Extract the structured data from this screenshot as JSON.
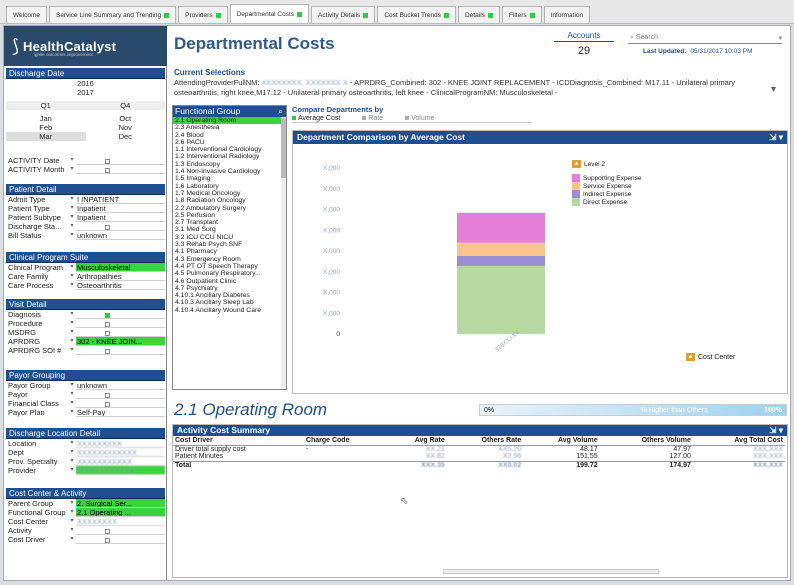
{
  "tabs": [
    {
      "label": "Welcome",
      "dot": false
    },
    {
      "label": "Service Line Summary and Trending",
      "dot": true
    },
    {
      "label": "Providers",
      "dot": true
    },
    {
      "label": "Departmental Costs",
      "dot": true,
      "active": true
    },
    {
      "label": "Activity Details",
      "dot": true
    },
    {
      "label": "Cost Bucket Trends",
      "dot": true
    },
    {
      "label": "Details",
      "dot": true
    },
    {
      "label": "Filters",
      "dot": true
    },
    {
      "label": "Information",
      "dot": false
    }
  ],
  "logo": {
    "name": "HealthCatalyst",
    "tagline": "ignite outcomes improvement"
  },
  "discharge_date": {
    "header": "Discharge Date",
    "years": [
      "2016",
      "2017"
    ],
    "quarters": [
      "Q1",
      "Q4"
    ],
    "months_left": [
      "Jan",
      "Feb",
      "Mar"
    ],
    "months_right": [
      "Oct",
      "Nov",
      "Dec"
    ]
  },
  "activity": {
    "date_label": "ACTIVITY Date",
    "month_label": "ACTIVITY Month"
  },
  "patient_detail": {
    "header": "Patient Detail",
    "rows": [
      {
        "label": "Admit Type",
        "value": "I INPATIENT"
      },
      {
        "label": "Patient Type",
        "value": "Inpatient"
      },
      {
        "label": "Patient Subtype",
        "value": "Inpatient"
      },
      {
        "label": "Discharge Sta...",
        "value": ""
      },
      {
        "label": "Bill Status",
        "value": "unknown"
      }
    ]
  },
  "clinical_program": {
    "header": "Clinical Program Suite",
    "rows": [
      {
        "label": "Clinical Program",
        "value": "Musculoskeletal",
        "green": true
      },
      {
        "label": "Care Family",
        "value": "Arthropathies"
      },
      {
        "label": "Care Process",
        "value": "Osteoarthritis"
      }
    ]
  },
  "visit_detail": {
    "header": "Visit Detail",
    "rows": [
      {
        "label": "Diagnosis",
        "value": "",
        "gsq": true
      },
      {
        "label": "Procedure",
        "value": ""
      },
      {
        "label": "MSDRG",
        "value": ""
      },
      {
        "label": "APRDRG",
        "value": "302 - KNEE JOIN...",
        "green": true
      },
      {
        "label": "APRDRG SOI #",
        "value": ""
      }
    ]
  },
  "payor_grouping": {
    "header": "Payor Grouping",
    "rows": [
      {
        "label": "Payor Group",
        "value": "unknown"
      },
      {
        "label": "Payor",
        "value": ""
      },
      {
        "label": "Financial Class",
        "value": ""
      },
      {
        "label": "Payor Plan",
        "value": "Self-Pay"
      }
    ]
  },
  "discharge_location": {
    "header": "Discharge Location Detail",
    "rows": [
      {
        "label": "Location",
        "value": "XXXXXXXXX",
        "blur": true
      },
      {
        "label": "Dept",
        "value": "XXXXXXXXXXXX",
        "blur": true
      },
      {
        "label": "Prov. Specialty",
        "value": "XXXXXXXXXXX",
        "blur": true
      },
      {
        "label": "Provider",
        "value": "XXXXXXXXXXXX",
        "green": true,
        "blur": true
      }
    ]
  },
  "cost_center_activity": {
    "header": "Cost Center & Activity",
    "rows": [
      {
        "label": "Parent Group",
        "value": "2. Surgical Ser...",
        "green": true
      },
      {
        "label": "Functional Group",
        "value": "2.1 Operating ...",
        "green": true
      },
      {
        "label": "Cost Center",
        "value": "XXXXXXXX",
        "blur": true
      },
      {
        "label": "Activity",
        "value": ""
      },
      {
        "label": "Cost Driver",
        "value": ""
      }
    ]
  },
  "header": {
    "title": "Departmental Costs",
    "accounts_label": "Accounts",
    "accounts_value": "29",
    "search_placeholder": "Search",
    "last_updated_label": "Last Updated:",
    "last_updated_value": "05/31/2017 10:03 PM"
  },
  "current_selections": {
    "header": "Current Selections",
    "prefix": "AttendingProviderFullNM: ",
    "blurred": "XXXXXXXX, XXXXXXX X",
    "rest": " - APRDRG_Combined: 302 - KNEE JOINT REPLACEMENT - ICDDiagnosis_Combined: M17.11 - Unilateral primary osteoarthritis, right knee,M17.12 - Unilateral primary osteoarthritis, left knee - ClinicalProgramNM: Musculoskeletal -"
  },
  "functional_group": {
    "header": "Functional Group",
    "items": [
      "2.1 Operating Room",
      "2.3 Anesthesia",
      "2.4 Blood",
      "2.6 PACU",
      "1.1 Interventional Cardiology",
      "1.2 Interventional Radiology",
      "1.3 Endoscopy",
      "1.4 Non-Invasive Cardiology",
      "1.5 Imaging",
      "1.6 Laboratory",
      "1.7 Medical Oncology",
      "1.8 Radiation Oncology",
      "2.2 Ambulatory Surgery",
      "2.5 Perfusion",
      "2.7 Transplant",
      "3.1 Med Surg",
      "3.2 ICU CCU NICU",
      "3.3 Rehab Psych SNF",
      "4.1 Pharmacy",
      "4.3 Emergency Room",
      "4.4 PT OT Speech Therapy",
      "4.5 Pulmonary Respiratory...",
      "4.6 Outpatient Clinic",
      "4.7 Psychiatry",
      "4.10.1 Ancillary Diabetes",
      "4.10.3 Ancillary Sleep Lab",
      "4.10.4 Ancillary Wound Care"
    ]
  },
  "compare": {
    "header": "Compare Departments by",
    "options": [
      {
        "label": "Average Cost",
        "active": true
      },
      {
        "label": "Rate",
        "active": false
      },
      {
        "label": "Volume",
        "active": false
      }
    ]
  },
  "chart_panel": {
    "header": "Department Comparison by Average Cost",
    "level_label": "Level 2",
    "cost_center_label": "Cost Center"
  },
  "chart_data": {
    "type": "bar",
    "stacked": true,
    "title": "Department Comparison by Average Cost",
    "categories": [
      "320XXXXX"
    ],
    "ytick_labels": [
      "X,000",
      "X,000",
      "X,000",
      "X,000",
      "X,000",
      "X,000",
      "X,000",
      "X,000",
      "0"
    ],
    "series": [
      {
        "name": "Supporting Expense",
        "color": "#e37fd6",
        "values": [
          0.18
        ]
      },
      {
        "name": "Service Expense",
        "color": "#f9c48a",
        "values": [
          0.08
        ]
      },
      {
        "name": "Indirect Expense",
        "color": "#9a8fd3",
        "values": [
          0.06
        ]
      },
      {
        "name": "Direct Expense",
        "color": "#b5d9a1",
        "values": [
          0.41
        ]
      }
    ],
    "ylim": [
      0,
      1
    ]
  },
  "detail": {
    "title": "2.1 Operating Room",
    "pct_left": "0%",
    "pct_mid": "% Higher than Others",
    "pct_right": "100%"
  },
  "activity_summary": {
    "header": "Activity Cost Summary",
    "columns": [
      "Cost Driver",
      "Charge Code",
      "Avg Rate",
      "Others Rate",
      "Avg Volume",
      "Others Volume",
      "Avg Total Cost"
    ],
    "rows": [
      [
        "Driver total supply cost",
        "-",
        "XX.21",
        "XX5.20",
        "48.17",
        "47.97",
        "XXX,XXX"
      ],
      [
        "Patient Minutes",
        "",
        "XX.82",
        "X2.96",
        "151.55",
        "127.00",
        "XXX,XXX"
      ]
    ],
    "total": [
      "Total",
      "",
      "XXX.35",
      "XX0.02",
      "199.72",
      "174.97",
      "XXX,XXX"
    ]
  }
}
